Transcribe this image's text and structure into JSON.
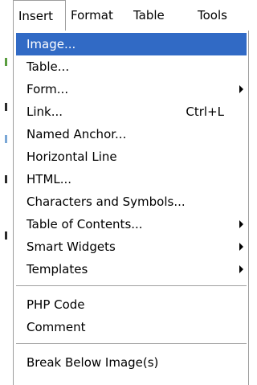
{
  "menubar": {
    "insert": "Insert",
    "format": "Format",
    "table": "Table",
    "tools": "Tools"
  },
  "menu": {
    "image": "Image...",
    "table": "Table...",
    "form": "Form...",
    "link": "Link...",
    "link_shortcut": "Ctrl+L",
    "named_anchor": "Named Anchor...",
    "horizontal_line": "Horizontal Line",
    "html": "HTML...",
    "characters_symbols": "Characters and Symbols...",
    "table_of_contents": "Table of Contents...",
    "smart_widgets": "Smart Widgets",
    "templates": "Templates",
    "php_code": "PHP Code",
    "comment": "Comment",
    "break_below_image": "Break Below Image(s)"
  },
  "colors": {
    "highlight": "#316ac5",
    "highlight_text": "#ffffff",
    "border": "#9d9d9d"
  }
}
